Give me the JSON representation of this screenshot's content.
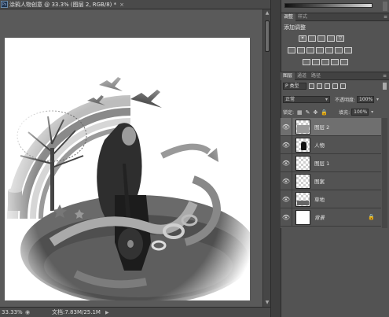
{
  "document": {
    "tab_title": "涂鸦人物创意 @ 33.3% (图层 2, RGB/8) *",
    "close_glyph": "×",
    "ps_badge": "Ps"
  },
  "status_bar": {
    "zoom": "33.33%",
    "doc_size": "文档:7.83M/25.1M",
    "arrow": "▶"
  },
  "panels": {
    "top_tabs": [
      "调整",
      "样式"
    ],
    "adjustments_title": "添加调整",
    "layers_tabs": [
      "图层",
      "通道",
      "路径"
    ],
    "menu_glyph": "≡"
  },
  "layers_panel": {
    "filter_kind": "P 类型",
    "blend_mode": "正常",
    "opacity_label": "不透明度:",
    "opacity_value": "100%",
    "lock_label": "锁定:",
    "fill_label": "填充:",
    "fill_value": "100%",
    "layers": [
      {
        "name": "图层 2",
        "selected": true,
        "thumb": "pattern",
        "locked": false,
        "italic": false
      },
      {
        "name": "人物",
        "selected": false,
        "thumb": "figure",
        "locked": false,
        "italic": false
      },
      {
        "name": "图层 1",
        "selected": false,
        "thumb": "checker",
        "locked": false,
        "italic": false
      },
      {
        "name": "图案",
        "selected": false,
        "thumb": "checker",
        "locked": false,
        "italic": false
      },
      {
        "name": "草地",
        "selected": false,
        "thumb": "grass",
        "locked": false,
        "italic": false
      },
      {
        "name": "背景",
        "selected": false,
        "thumb": "white",
        "locked": true,
        "italic": true
      }
    ]
  },
  "colors": {
    "workspace": "#3a3a3a",
    "panel": "#535353",
    "selected_row": "#6f6f6f"
  }
}
